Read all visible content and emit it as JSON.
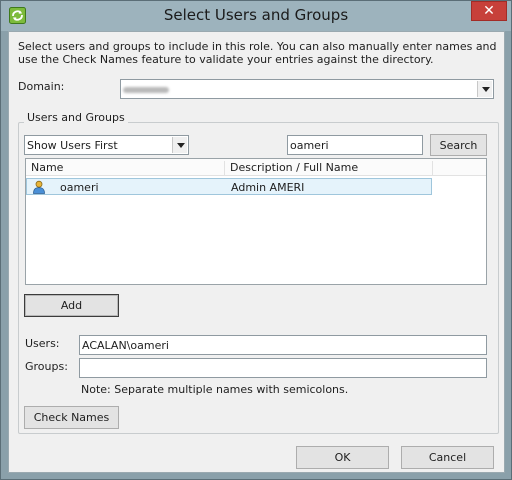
{
  "window": {
    "title": "Select Users and Groups",
    "close_glyph": "✕",
    "app_icon": "vsphere-app-icon"
  },
  "intro_text": "Select users and groups to include in this role. You can also manually enter names and use the Check Names feature to validate your entries against the directory.",
  "domain": {
    "label": "Domain:",
    "value_redacted": true
  },
  "users_and_groups": {
    "legend": "Users and Groups",
    "filter_selected": "Show Users First",
    "search_value": "oameri",
    "search_button": "Search",
    "columns": [
      "Name",
      "Description / Full Name"
    ],
    "rows": [
      {
        "name": "oameri",
        "description": "Admin AMERI",
        "icon": "user-icon",
        "selected": true
      }
    ],
    "add_button": "Add",
    "users_label": "Users:",
    "users_value": "ACALAN\\oameri",
    "groups_label": "Groups:",
    "groups_value": "",
    "note": "Note: Separate multiple names with semicolons.",
    "check_names_button": "Check Names"
  },
  "footer": {
    "ok_button": "OK",
    "cancel_button": "Cancel"
  },
  "colors": {
    "title_bar": "#9db3bd",
    "close_button": "#c7403a",
    "selection": "#e5f3fb",
    "client_bg": "#f0f0f0"
  }
}
